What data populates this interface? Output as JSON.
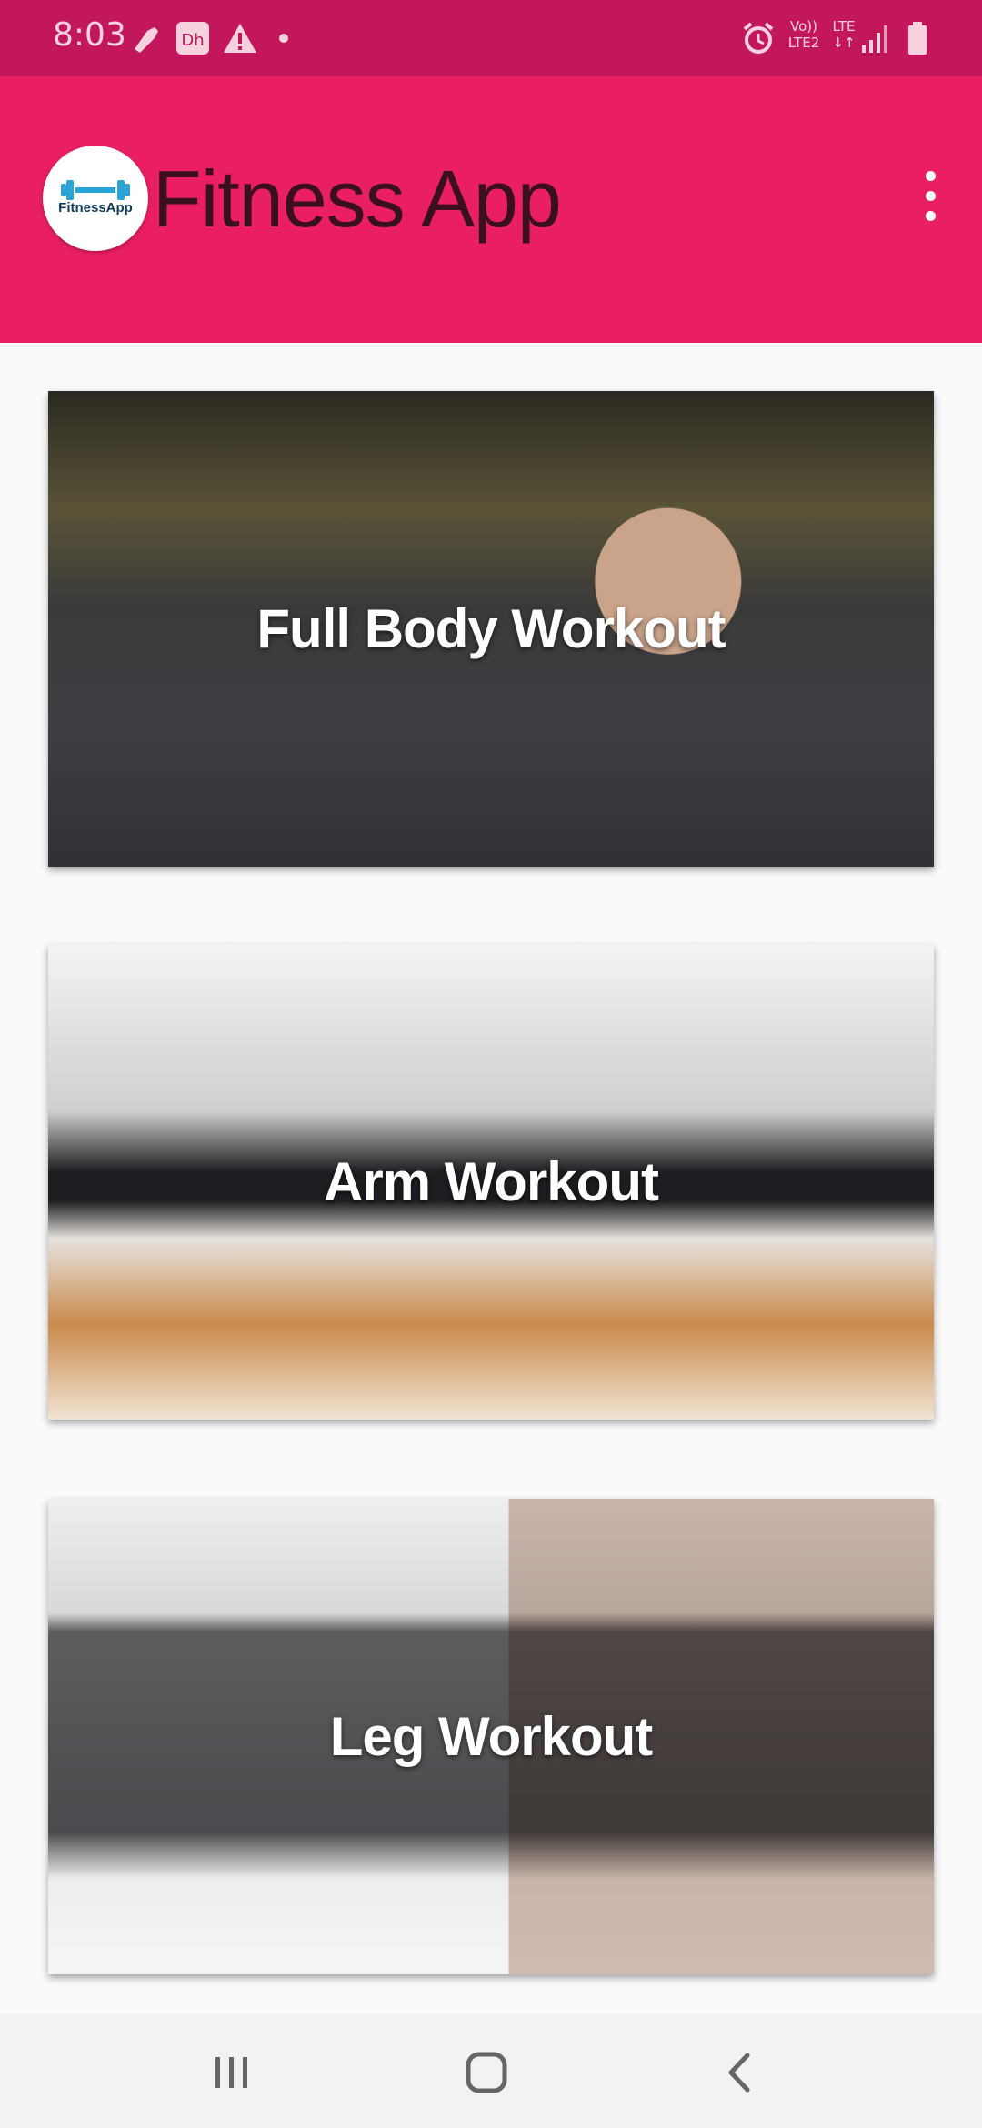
{
  "status_bar": {
    "time": "8:03",
    "icons": [
      "notification-icon",
      "app-icon",
      "warning-icon",
      "dot-icon",
      "alarm-icon",
      "volte-icon",
      "signal-icon",
      "battery-icon"
    ],
    "network_label_1": "Vo))",
    "network_label_2": "LTE2",
    "network_label_3": "LTE"
  },
  "app_bar": {
    "title": "Fitness App",
    "logo_text": "FitnessApp",
    "background_color": "#e91e63",
    "status_color": "#c2185b"
  },
  "workouts": [
    {
      "label": "Full Body Workout"
    },
    {
      "label": "Arm Workout"
    },
    {
      "label": "Leg Workout"
    }
  ],
  "nav_bar": {
    "icons": [
      "recent-apps-icon",
      "home-icon",
      "back-icon"
    ]
  }
}
